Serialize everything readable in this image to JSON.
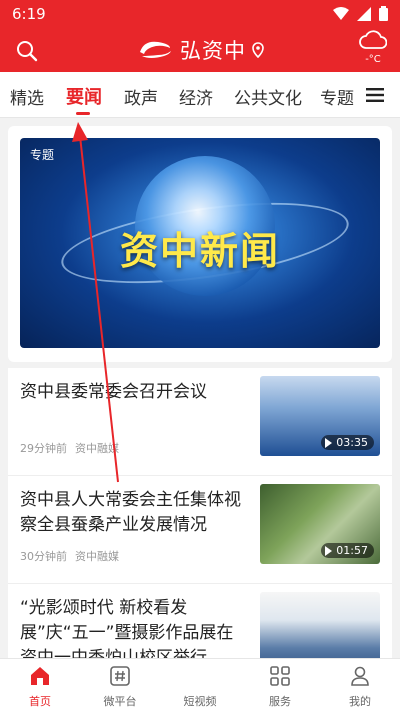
{
  "status_bar": {
    "time": "6:19"
  },
  "header": {
    "logo_text": "弘资中",
    "weather_temp": "-°C"
  },
  "tabs": [
    {
      "label": "精选"
    },
    {
      "label": "要闻"
    },
    {
      "label": "政声"
    },
    {
      "label": "经济"
    },
    {
      "label": "公共文化"
    },
    {
      "label": "专题"
    }
  ],
  "feature": {
    "tag": "专题",
    "banner_title": "资中新闻"
  },
  "news": [
    {
      "title": "资中县委常委会召开会议",
      "time": "29分钟前",
      "source": "资中融媒",
      "duration": "03:35"
    },
    {
      "title": "资中县人大常委会主任集体视察全县蚕桑产业发展情况",
      "time": "30分钟前",
      "source": "资中融媒",
      "duration": "01:57"
    },
    {
      "title": "“光影颂时代 新校看发展”庆“五一”暨摄影作品展在资中一中香炉山校区举行",
      "time": "",
      "source": "",
      "duration": ""
    }
  ],
  "bottom_nav": [
    {
      "label": "首页"
    },
    {
      "label": "微平台"
    },
    {
      "label": "短视频"
    },
    {
      "label": "服务"
    },
    {
      "label": "我的"
    }
  ],
  "colors": {
    "brand_red": "#e8262a",
    "text_primary": "#222222",
    "meta_gray": "#999999"
  }
}
